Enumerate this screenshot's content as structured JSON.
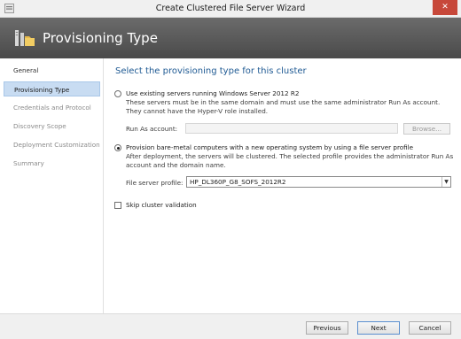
{
  "window": {
    "title": "Create Clustered File Server Wizard",
    "close_glyph": "✕"
  },
  "banner": {
    "title": "Provisioning Type",
    "icon": "cluster-server-icon"
  },
  "sidebar": {
    "items": [
      {
        "label": "General"
      },
      {
        "label": "Provisioning Type"
      },
      {
        "label": "Credentials and Protocol"
      },
      {
        "label": "Discovery Scope"
      },
      {
        "label": "Deployment Customization"
      },
      {
        "label": "Summary"
      }
    ],
    "active_index": 1
  },
  "main": {
    "heading": "Select the provisioning type for this cluster",
    "option_existing": {
      "label": "Use existing servers running Windows Server 2012 R2",
      "desc_line1": "These servers must be in the same domain and must use the same administrator Run As account.",
      "desc_line2": "They cannot have the Hyper-V role installed.",
      "run_as_label": "Run As account:",
      "run_as_value": "",
      "browse_label": "Browse...",
      "selected": false
    },
    "option_baremetal": {
      "label": "Provision bare-metal computers with a new operating system by using a file server profile",
      "desc_line1": "After deployment, the servers will be clustered. The selected profile provides the administrator Run As",
      "desc_line2": "account and the domain name.",
      "profile_label": "File server profile:",
      "profile_value": "HP_DL360P_G8_SOFS_2012R2",
      "selected": true
    },
    "skip_validation": {
      "label": "Skip cluster validation",
      "checked": false
    }
  },
  "footer": {
    "previous_label": "Previous",
    "next_label": "Next",
    "cancel_label": "Cancel"
  },
  "colors": {
    "heading": "#1f5a93",
    "banner": "#555555",
    "active_nav": "#c8dcf2",
    "close_button": "#c7483a"
  }
}
